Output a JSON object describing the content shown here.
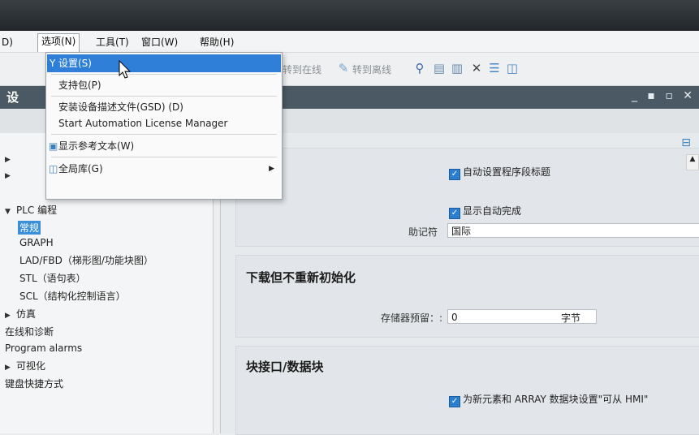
{
  "menubar": {
    "items": [
      "D)",
      "选项(N)",
      "工具(T)",
      "窗口(W)",
      "帮助(H)"
    ]
  },
  "toolbar": {
    "go_online": "转到在线",
    "go_offline": "转到离线"
  },
  "window": {
    "title": "设",
    "controls": "_ ▪ ▫ ✕"
  },
  "dropdown": {
    "items": [
      {
        "label": "设置(S)",
        "icon": "wrench-icon"
      },
      {
        "label": "支持包(P)"
      },
      {
        "label": "安装设备描述文件(GSD) (D)"
      },
      {
        "label": "Start Automation License Manager"
      },
      {
        "label": "显示参考文本(W)",
        "icon": "reference-text-icon"
      },
      {
        "label": "全局库(G)",
        "icon": "global-library-icon",
        "submenu": true
      }
    ]
  },
  "tree": {
    "plc": "PLC 编程",
    "general": "常规",
    "graph": "GRAPH",
    "ladfbd": "LAD/FBD（梯形图/功能块图）",
    "stl": "STL（语句表）",
    "scl": "SCL（结构化控制语言）",
    "sim": "仿真",
    "online": "在线和诊断",
    "alarms": "Program alarms",
    "vis": "可视化",
    "keys": "键盘快捷方式"
  },
  "settings": {
    "auto_title": "自动设置程序段标题",
    "show_autocomplete": "显示自动完成",
    "mnemonic_label": "助记符",
    "mnemonic_value": "国际",
    "section_download": "下载但不重新初始化",
    "memory_label": "存储器预留：:",
    "memory_value": "0",
    "memory_unit": "字节",
    "section_block": "块接口/数据块",
    "array_setting": "为新元素和 ARRAY 数据块设置\"可从 HMI\""
  }
}
